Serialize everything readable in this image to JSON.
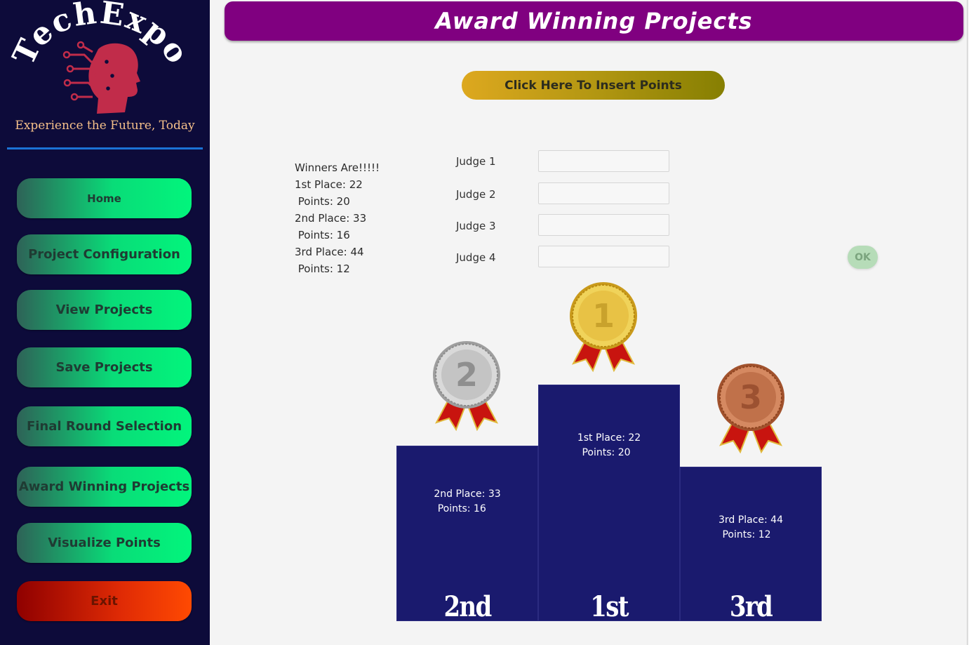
{
  "sidebar": {
    "logo_text": "TechExpo",
    "tagline": "Experience the Future, Today",
    "nav": [
      {
        "label": "Home"
      },
      {
        "label": "Project Configuration"
      },
      {
        "label": "View Projects"
      },
      {
        "label": "Save Projects"
      },
      {
        "label": "Final Round Selection"
      },
      {
        "label": "Award Winning Projects"
      },
      {
        "label": "Visualize Points"
      }
    ],
    "exit_label": "Exit"
  },
  "header": {
    "title": "Award Winning Projects"
  },
  "insert_button": {
    "label": "Click Here To Insert Points"
  },
  "winners": {
    "heading": "Winners Are!!!!!",
    "lines": [
      "1st Place: 22",
      " Points: 20",
      "2nd Place: 33",
      " Points: 16",
      "3rd Place: 44",
      " Points: 12"
    ]
  },
  "judges": [
    {
      "label": "Judge 1",
      "value": ""
    },
    {
      "label": "Judge 2",
      "value": ""
    },
    {
      "label": "Judge 3",
      "value": ""
    },
    {
      "label": "Judge 4",
      "value": ""
    }
  ],
  "ok_button": {
    "label": "OK"
  },
  "podium": {
    "second": {
      "place": "2nd Place: 33",
      "points": " Points: 16",
      "rank": "2nd",
      "medal": "2"
    },
    "first": {
      "place": "1st Place: 22",
      "points": "Points: 20",
      "rank": "1st",
      "medal": "1"
    },
    "third": {
      "place": "3rd Place: 44",
      "points": "Points: 12",
      "rank": "3rd",
      "medal": "3"
    }
  },
  "colors": {
    "header_bg": "#800080",
    "sidebar_bg": "#0d0b3a",
    "podium_bg": "#1a1a6e",
    "nav_gradient_end": "#02f57c",
    "exit_gradient_end": "#ff4a02",
    "gold": "#e8c245",
    "silver": "#b9b9b9",
    "bronze": "#c0714a",
    "ribbon": "#c8140f"
  }
}
